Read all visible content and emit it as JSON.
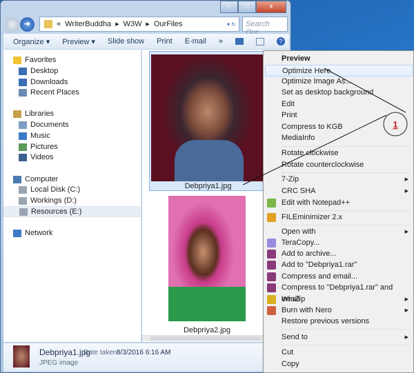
{
  "window": {
    "breadcrumb": [
      "«",
      "WriterBuddha",
      "W3W",
      "OurFiles"
    ],
    "search_placeholder": "Search Our...",
    "controls": {
      "minimize": "–",
      "maximize": "□",
      "close": "x"
    }
  },
  "toolbar": {
    "organize": "Organize ▾",
    "preview": "Preview ▾",
    "slideshow": "Slide show",
    "print": "Print",
    "email": "E-mail",
    "more": "»"
  },
  "nav": [
    {
      "label": "Favorites",
      "icon": "star-icon",
      "color": "#f2c230"
    },
    {
      "label": "Desktop",
      "icon": "desktop-icon",
      "color": "#3a6fb5"
    },
    {
      "label": "Downloads",
      "icon": "downloads-icon",
      "color": "#3a6fb5"
    },
    {
      "label": "Recent Places",
      "icon": "recent-icon",
      "color": "#6a8bb4"
    },
    {
      "label": "Libraries",
      "icon": "libraries-icon",
      "color": "#c9a04a"
    },
    {
      "label": "Documents",
      "icon": "documents-icon",
      "color": "#7f9cc4"
    },
    {
      "label": "Music",
      "icon": "music-icon",
      "color": "#3c7ac6"
    },
    {
      "label": "Pictures",
      "icon": "pictures-icon",
      "color": "#5a9a5a"
    },
    {
      "label": "Videos",
      "icon": "videos-icon",
      "color": "#3e5f8e"
    },
    {
      "label": "Computer",
      "icon": "computer-icon",
      "color": "#4a7ab0"
    },
    {
      "label": "Local Disk (C:)",
      "icon": "drive-icon",
      "color": "#9aa5b1"
    },
    {
      "label": "Workings (D:)",
      "icon": "drive-icon",
      "color": "#9aa5b1"
    },
    {
      "label": "Resources (E:)",
      "icon": "drive-icon",
      "color": "#9aa5b1"
    },
    {
      "label": "Network",
      "icon": "network-icon",
      "color": "#3c7ac6"
    }
  ],
  "files": [
    {
      "name": "Debpriya1.jpg",
      "selected": true
    },
    {
      "name": "Debpriya2.jpg",
      "selected": false
    }
  ],
  "status": {
    "name": "Debpriya1.jpg",
    "date_label": "Date taken:",
    "date": "8/3/2016 6:16 AM",
    "type": "JPEG image"
  },
  "menu": [
    {
      "label": "Preview",
      "bold": true
    },
    {
      "label": "Optimize Here",
      "highlight": true
    },
    {
      "label": "Optimize Image As..."
    },
    {
      "label": "Set as desktop background"
    },
    {
      "label": "Edit"
    },
    {
      "label": "Print"
    },
    {
      "label": "Compress to KGB"
    },
    {
      "label": "MediaInfo"
    },
    {
      "label": "Rotate clockwise"
    },
    {
      "label": "Rotate counterclockwise"
    },
    {
      "label": "7-Zip",
      "submenu": true
    },
    {
      "label": "CRC SHA",
      "submenu": true
    },
    {
      "label": "Edit with Notepad++",
      "icon": "notepadpp-icon"
    },
    {
      "label": "FILEminimizer 2.x",
      "icon": "fileminimizer-icon"
    },
    {
      "label": "Open with",
      "submenu": true
    },
    {
      "label": "TeraCopy...",
      "icon": "teracopy-icon"
    },
    {
      "label": "Add to archive...",
      "icon": "winrar-icon"
    },
    {
      "label": "Add to \"Debpriya1.rar\"",
      "icon": "winrar-icon"
    },
    {
      "label": "Compress and email...",
      "icon": "winrar-icon"
    },
    {
      "label": "Compress to \"Debpriya1.rar\" and email",
      "icon": "winrar-icon"
    },
    {
      "label": "WinZip",
      "icon": "winzip-icon",
      "submenu": true
    },
    {
      "label": "Burn with Nero",
      "icon": "nero-icon",
      "submenu": true
    },
    {
      "label": "Restore previous versions"
    },
    {
      "label": "Send to",
      "submenu": true
    },
    {
      "label": "Cut"
    },
    {
      "label": "Copy"
    }
  ],
  "annotation": {
    "number": "1"
  }
}
